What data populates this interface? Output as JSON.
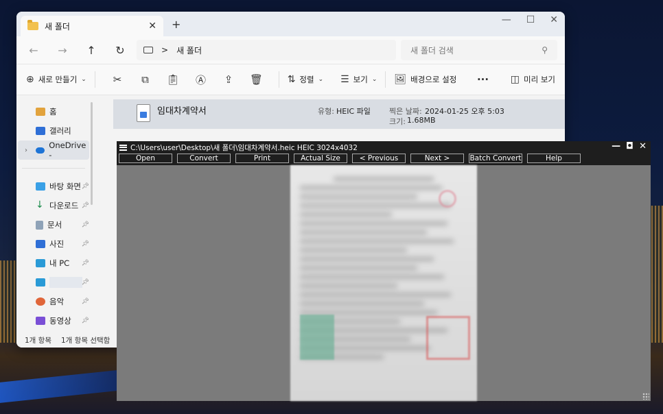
{
  "explorer": {
    "tab_title": "새 폴더",
    "new_tab": "+",
    "address": {
      "breadcrumb_sep": ">",
      "folder": "새 폴더"
    },
    "search_placeholder": "새 폴더 검색",
    "toolbar": {
      "new_label": "새로 만들기",
      "sort_label": "정렬",
      "view_label": "보기",
      "set_background_label": "배경으로 설정",
      "more_label": "···",
      "preview_label": "미리 보기"
    },
    "sidebar": {
      "items": [
        {
          "label": "홈"
        },
        {
          "label": "갤러리"
        },
        {
          "label": "OneDrive -"
        },
        {
          "label": "바탕 화면"
        },
        {
          "label": "다운로드"
        },
        {
          "label": "문서"
        },
        {
          "label": "사진"
        },
        {
          "label": "내 PC"
        },
        {
          "label": ""
        },
        {
          "label": "음악"
        },
        {
          "label": "동영상"
        }
      ]
    },
    "file": {
      "name": "임대차계약서",
      "type_label": "유형:",
      "type_value": "HEIC 파일",
      "date_label": "찍은 날짜:",
      "date_value": "2024-01-25 오후 5:03",
      "size_label": "크기:",
      "size_value": "1.68MB"
    },
    "status": {
      "count": "1개 항목",
      "selected": "1개 항목 선택함"
    }
  },
  "viewer": {
    "title": "C:\\Users\\user\\Desktop\\새 폴더\\임대차계약서.heic HEIC 3024x4032",
    "buttons": [
      "Open",
      "Convert",
      "Print",
      "Actual Size",
      "< Previous",
      "Next >",
      "Batch Convert",
      "Help"
    ]
  },
  "colors": {
    "accent": "#1d6cff",
    "viewer_bg": "#7b7b7b",
    "titlebar": "#1e1e1e"
  }
}
